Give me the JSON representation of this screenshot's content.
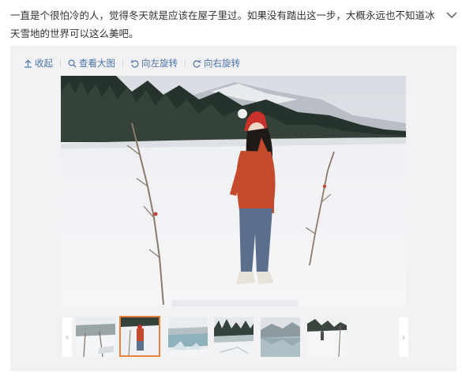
{
  "post": {
    "text": "一直是个很怕冷的人，觉得冬天就是应该在屋子里过。如果没有踏出这一步，大概永远也不知道冰天雪地的世界可以这么美吧。",
    "collapse_icon": "chevron-down-icon"
  },
  "toolbar": {
    "collapse_label": "收起",
    "view_large_label": "查看大图",
    "rotate_left_label": "向左旋转",
    "rotate_right_label": "向右旋转"
  },
  "gallery": {
    "prev_arrow": "‹",
    "next_arrow": "›",
    "thumbnails": [
      {
        "scene": "snow-field-trees",
        "selected": false
      },
      {
        "scene": "girl-red-sweater",
        "selected": true
      },
      {
        "scene": "ice-blocks-lake",
        "selected": false
      },
      {
        "scene": "frozen-shore-forest",
        "selected": false
      },
      {
        "scene": "lake-reflection",
        "selected": false
      },
      {
        "scene": "person-in-snow",
        "selected": false
      }
    ]
  },
  "colors": {
    "link": "#4a73a6",
    "selected_border": "#e8823d",
    "panel_bg": "#f2f2f5"
  }
}
